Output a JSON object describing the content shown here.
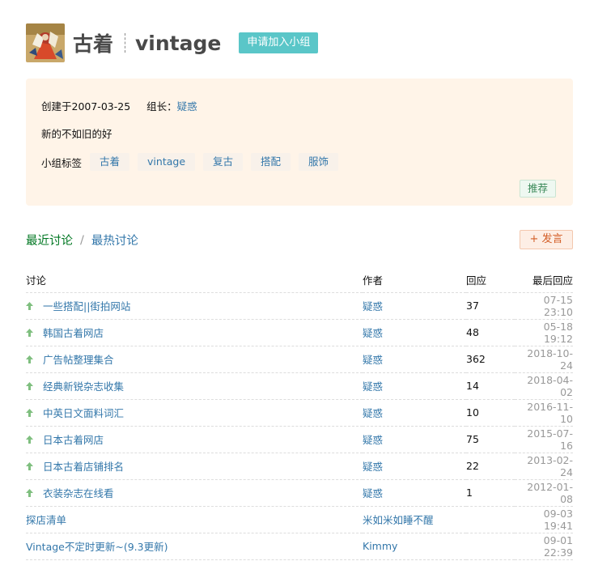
{
  "group": {
    "name": "古着",
    "name_en": "vintage",
    "join_label": "申请加入小组"
  },
  "info": {
    "created": "创建于2007-03-25",
    "owner_label": "组长：",
    "owner_name": "疑惑",
    "description": "新的不如旧的好",
    "tags_label": "小组标签",
    "tags": [
      "古着",
      "vintage",
      "复古",
      "搭配",
      "服饰"
    ],
    "recommend_label": "推荐"
  },
  "tabs": {
    "recent": "最近讨论",
    "separator": "/",
    "hot": "最热讨论",
    "post_label": "+ 发言"
  },
  "table": {
    "headers": [
      "讨论",
      "作者",
      "回应",
      "最后回应"
    ],
    "rows": [
      {
        "title": "一些搭配||街拍网站",
        "author": "疑惑",
        "replies": "37",
        "last": "07-15 23:10",
        "sticky": true
      },
      {
        "title": "韩国古着网店",
        "author": "疑惑",
        "replies": "48",
        "last": "05-18 19:12",
        "sticky": true
      },
      {
        "title": "广告帖整理集合",
        "author": "疑惑",
        "replies": "362",
        "last": "2018-10-24",
        "sticky": true
      },
      {
        "title": "经典新锐杂志收集",
        "author": "疑惑",
        "replies": "14",
        "last": "2018-04-02",
        "sticky": true
      },
      {
        "title": "中英日文面料词汇",
        "author": "疑惑",
        "replies": "10",
        "last": "2016-11-10",
        "sticky": true
      },
      {
        "title": "日本古着网店",
        "author": "疑惑",
        "replies": "75",
        "last": "2015-07-16",
        "sticky": true
      },
      {
        "title": "日本古着店铺排名",
        "author": "疑惑",
        "replies": "22",
        "last": "2013-02-24",
        "sticky": true
      },
      {
        "title": "衣装杂志在线看",
        "author": "疑惑",
        "replies": "1",
        "last": "2012-01-08",
        "sticky": true
      },
      {
        "title": "探店清单",
        "author": "米如米如睡不醒",
        "replies": "",
        "last": "09-03 19:41",
        "sticky": false
      },
      {
        "title": "Vintage不定时更新~(9.3更新)",
        "author": "Kimmy",
        "replies": "",
        "last": "09-01 22:39",
        "sticky": false
      }
    ]
  },
  "icons": {
    "sticky": "up-arrow-icon",
    "sticky_color": "#7fbf7f"
  }
}
